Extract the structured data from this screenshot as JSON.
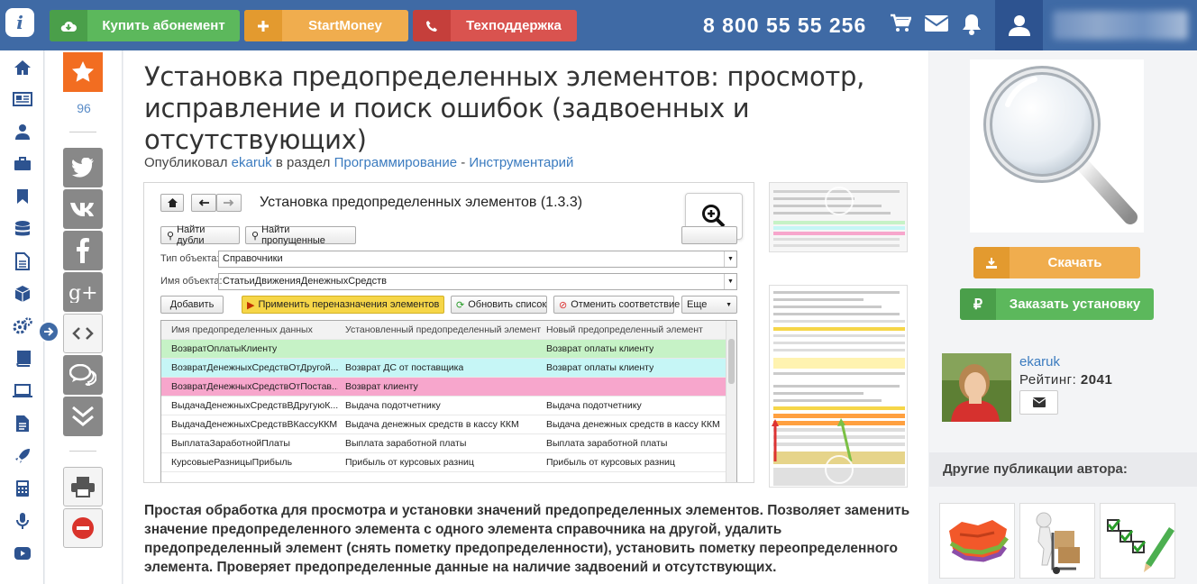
{
  "topbar": {
    "buy_label": "Купить абонемент",
    "startmoney_label": "StartMoney",
    "support_label": "Техподдержка",
    "phone": "8 800 55 55 256"
  },
  "social": {
    "fav_count": "96"
  },
  "article": {
    "title": "Установка предопределенных элементов: просмотр, исправление и поиск ошибок (задвоенных и отсутствующих)",
    "meta_prefix": "Опубликовал",
    "author": "ekaruk",
    "meta_mid": "в раздел",
    "section": "Программирование",
    "meta_sep": "-",
    "subsection": "Инструментарий",
    "description": "Простая обработка для просмотра и установки значений предопределенных элементов. Позволяет заменить значение предопределенного элемента с одного элемента справочника на другой, удалить предопределенный элемент (снять пометку предопределенности), установить пометку переопределенного элемента. Проверяет предопределенные данные на наличие задвоений и отсутствующих."
  },
  "screenshot": {
    "window_title": "Установка предопределенных элементов (1.3.3)",
    "find_dupes": "Найти дубли",
    "find_missing": "Найти пропущенные",
    "type_label": "Тип объекта:",
    "type_value": "Справочники",
    "name_label": "Имя объекта:",
    "name_value": "СтатьиДвиженияДенежныхСредств",
    "add_btn": "Добавить",
    "apply_btn": "Применить переназначения элементов",
    "refresh_btn": "Обновить список",
    "cancel_btn": "Отменить соответствие",
    "more_btn": "Еще",
    "columns": [
      "Имя предопределенных данных",
      "Установленный предопределенный элемент",
      "Новый предопределенный элемент"
    ],
    "rows": [
      [
        "ВозвратОплатыКлиенту",
        "",
        "Возврат оплаты клиенту"
      ],
      [
        "ВозвратДенежныхСредствОтДругой...",
        "Возврат ДС от поставщика",
        "Возврат оплаты клиенту"
      ],
      [
        "ВозвратДенежныхСредствОтПостав...",
        "Возврат клиенту",
        ""
      ],
      [
        "ВыдачаДенежныхСредствВДругуюК...",
        "Выдача подотчетнику",
        "Выдача подотчетнику"
      ],
      [
        "ВыдачаДенежныхСредствВКассуККМ",
        "Выдача денежных средств в кассу ККМ",
        "Выдача денежных средств в кассу ККМ"
      ],
      [
        "ВыплатаЗаработнойПлаты",
        "Выплата заработной платы",
        "Выплата заработной платы"
      ],
      [
        "КурсовыеРазницыПрибыль",
        "Прибыль от курсовых разниц",
        "Прибыль от курсовых разниц"
      ]
    ],
    "row_colors": [
      "#c6f2c6",
      "#c6f6f6",
      "#f7a6cc",
      "#ffffff",
      "#ffffff",
      "#ffffff",
      "#ffffff"
    ]
  },
  "sidebar_right": {
    "download_label": "Скачать",
    "order_label": "Заказать установку",
    "author_name": "ekaruk",
    "rating_label": "Рейтинг:",
    "rating_value": "2041",
    "other_pubs": "Другие публикации автора:"
  },
  "icons": {
    "nav": [
      "home-icon",
      "news-icon",
      "user-icon",
      "briefcase-icon",
      "bookmark-icon",
      "database-icon",
      "document-icon",
      "cube-icon",
      "gears-icon",
      "book-icon",
      "laptop-icon",
      "file-icon",
      "rocket-icon",
      "calculator-icon",
      "microphone-icon",
      "youtube-icon"
    ],
    "social": [
      "twitter-icon",
      "vk-icon",
      "facebook-icon",
      "google-plus-icon",
      "code-icon",
      "comments-icon",
      "chevrons-down-icon"
    ]
  },
  "colors": {
    "brand_blue": "#3f6aa5",
    "green": "#5cb85c",
    "orange": "#f0ad4e",
    "red": "#d9534f",
    "fav_orange": "#f26d21",
    "link": "#3b7bbf"
  }
}
